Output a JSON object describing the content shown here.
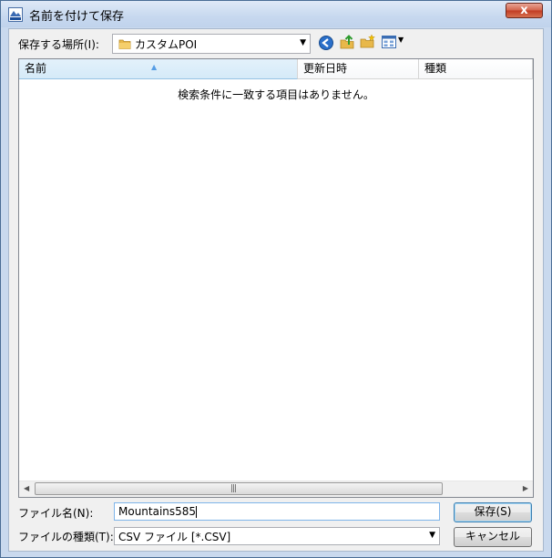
{
  "window": {
    "title": "名前を付けて保存",
    "close_label": "x"
  },
  "location": {
    "label": "保存する場所(I):",
    "value": "カスタムPOI",
    "icon": "folder-icon"
  },
  "toolbar": {
    "icons": [
      "back-icon",
      "up-folder-icon",
      "new-folder-icon",
      "view-menu-icon"
    ]
  },
  "file_list": {
    "columns": [
      "名前",
      "更新日時",
      "種類"
    ],
    "sorted_column": "名前",
    "empty_message": "検索条件に一致する項目はありません。"
  },
  "filename": {
    "label": "ファイル名(N):",
    "value": "Mountains585"
  },
  "filetype": {
    "label": "ファイルの種類(T):",
    "value": "CSV ファイル [*.CSV]"
  },
  "buttons": {
    "save": "保存(S)",
    "cancel": "キャンセル"
  },
  "scrollbar": {
    "grip": "|||"
  },
  "colors": {
    "title_bg": "#c7d8ef",
    "close_red": "#c13b22",
    "client_bg": "#f0f0f0",
    "folder_yellow": "#e8b84a",
    "back_blue": "#2a6fc9",
    "default_button_border": "#3c7fb1"
  }
}
